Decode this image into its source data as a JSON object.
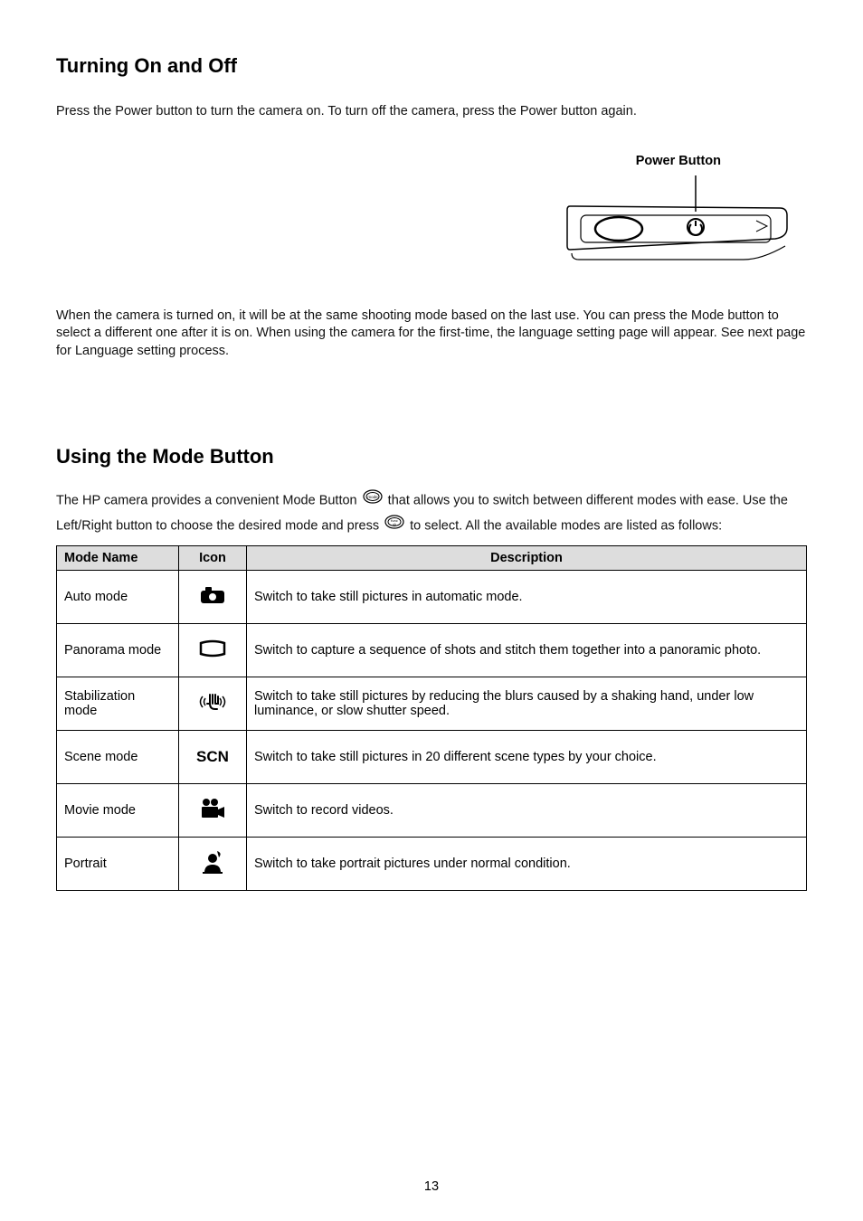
{
  "headings": {
    "h1": "Turning On and Off",
    "h2": "Using the Mode Button"
  },
  "para1": "Press the Power button to turn the camera on. To turn off the camera, press the Power button again.",
  "figure": {
    "label": "Power Button"
  },
  "para2": "When the camera is turned on, it will be at the same shooting mode based on the last use. You can press the Mode button to select a different one after it is on. When using the camera for the first-time, the language setting page will appear. See next page for Language setting process.",
  "para3a": "The HP camera provides a convenient Mode Button ",
  "para3b": " that allows you to switch between different modes with ease. Use the Left/Right button to choose the desired mode and  press ",
  "para3c": " to select. All the available modes are listed as follows:",
  "table": {
    "headers": {
      "name": "Mode Name",
      "icon": "Icon",
      "desc": "Description"
    },
    "rows": [
      {
        "name": "Auto mode",
        "icon": "auto-mode-icon",
        "desc": "Switch to take still pictures in automatic mode."
      },
      {
        "name": "Panorama mode",
        "icon": "panorama-mode-icon",
        "desc": "Switch to capture a sequence of shots and stitch them together into a panoramic photo."
      },
      {
        "name": "Stabilization mode",
        "icon": "stabilization-mode-icon",
        "desc": "Switch to take still pictures by reducing the blurs caused by a shaking hand, under low luminance, or slow shutter speed."
      },
      {
        "name": "Scene mode",
        "icon": "scene-mode-icon",
        "iconText": "SCN",
        "desc": "Switch to take still pictures in 20 different scene types by your choice."
      },
      {
        "name": "Movie mode",
        "icon": "movie-mode-icon",
        "desc": "Switch to record videos."
      },
      {
        "name": "Portrait",
        "icon": "portrait-mode-icon",
        "desc": "Switch to take portrait pictures under normal condition."
      }
    ]
  },
  "pageNumber": "13"
}
